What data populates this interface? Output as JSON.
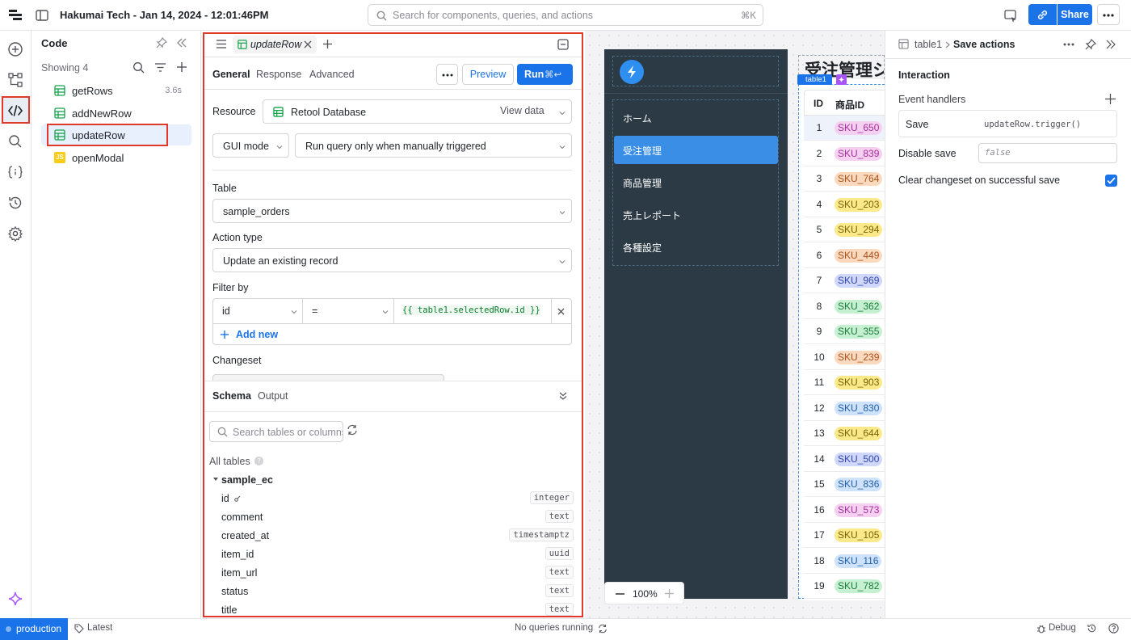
{
  "topbar": {
    "title": "Hakumai Tech - Jan 14, 2024 - 12:01:46PM",
    "search_placeholder": "Search for components, queries, and actions",
    "search_shortcut": "⌘K",
    "share_label": "Share"
  },
  "code_panel": {
    "title": "Code",
    "showing": "Showing 4",
    "queries": [
      {
        "name": "getRows",
        "time": "3.6s",
        "icon": "table-icon"
      },
      {
        "name": "addNewRow",
        "time": "",
        "icon": "table-icon"
      },
      {
        "name": "updateRow",
        "time": "",
        "icon": "table-icon"
      },
      {
        "name": "openModal",
        "time": "",
        "icon": "js-icon"
      }
    ],
    "js_badge": "JS"
  },
  "editor": {
    "tab_name": "updateRow",
    "subtabs": [
      "General",
      "Response",
      "Advanced"
    ],
    "preview_label": "Preview",
    "run_label": "Run",
    "run_shortcut": "⌘↩",
    "resource_label": "Resource",
    "resource_value": "Retool Database",
    "view_data": "View data",
    "mode_value": "GUI mode",
    "trigger_value": "Run query only when manually triggered",
    "table_label": "Table",
    "table_value": "sample_orders",
    "action_type_label": "Action type",
    "action_type_value": "Update an existing record",
    "filter_label": "Filter by",
    "filter_column": "id",
    "filter_operator": "=",
    "filter_value": "{{ table1.selectedRow.id }}",
    "add_new_label": "Add new",
    "changeset_label": "Changeset",
    "bottom_tabs": [
      "Schema",
      "Output"
    ],
    "schema_search_placeholder": "Search tables or columns",
    "all_tables_label": "All tables",
    "schema_table": "sample_ec",
    "schema_columns": [
      {
        "name": "id",
        "type": "integer"
      },
      {
        "name": "comment",
        "type": "text"
      },
      {
        "name": "created_at",
        "type": "timestamptz"
      },
      {
        "name": "item_id",
        "type": "uuid"
      },
      {
        "name": "item_url",
        "type": "text"
      },
      {
        "name": "status",
        "type": "text"
      },
      {
        "name": "title",
        "type": "text"
      }
    ]
  },
  "canvas": {
    "heading": "受注管理シ",
    "table_tag": "table1",
    "nav_items": [
      "ホーム",
      "受注管理",
      "商品管理",
      "売上レポート",
      "各種設定"
    ],
    "active_nav": "受注管理",
    "columns": [
      "ID",
      "商品ID"
    ],
    "rows": [
      {
        "id": "1",
        "sku": "SKU_650",
        "color": "#f5d0f0"
      },
      {
        "id": "2",
        "sku": "SKU_839",
        "color": "#f5d0f0"
      },
      {
        "id": "3",
        "sku": "SKU_764",
        "color": "#fbd9bf"
      },
      {
        "id": "4",
        "sku": "SKU_203",
        "color": "#fbe98a"
      },
      {
        "id": "5",
        "sku": "SKU_294",
        "color": "#fbe98a"
      },
      {
        "id": "6",
        "sku": "SKU_449",
        "color": "#fbd9bf"
      },
      {
        "id": "7",
        "sku": "SKU_969",
        "color": "#cfd8fb"
      },
      {
        "id": "8",
        "sku": "SKU_362",
        "color": "#c6f0d2"
      },
      {
        "id": "9",
        "sku": "SKU_355",
        "color": "#c6f0d2"
      },
      {
        "id": "10",
        "sku": "SKU_239",
        "color": "#fbd9bf"
      },
      {
        "id": "11",
        "sku": "SKU_903",
        "color": "#fbe98a"
      },
      {
        "id": "12",
        "sku": "SKU_830",
        "color": "#cfe2fb"
      },
      {
        "id": "13",
        "sku": "SKU_644",
        "color": "#fbe98a"
      },
      {
        "id": "14",
        "sku": "SKU_500",
        "color": "#cfd8fb"
      },
      {
        "id": "15",
        "sku": "SKU_836",
        "color": "#cfe2fb"
      },
      {
        "id": "16",
        "sku": "SKU_573",
        "color": "#f5d0f0"
      },
      {
        "id": "17",
        "sku": "SKU_105",
        "color": "#fbe98a"
      },
      {
        "id": "18",
        "sku": "SKU_116",
        "color": "#cfe2fb"
      },
      {
        "id": "19",
        "sku": "SKU_782",
        "color": "#c6f0d2"
      }
    ],
    "zoom": "100%"
  },
  "inspector": {
    "breadcrumb_parent": "table1",
    "breadcrumb_current": "Save actions",
    "section": "Interaction",
    "event_handlers_label": "Event handlers",
    "handler_event": "Save",
    "handler_action": "updateRow.trigger()",
    "disable_save_label": "Disable save",
    "disable_save_value": "false",
    "clear_changeset_label": "Clear changeset on successful save",
    "clear_changeset_checked": true
  },
  "footer": {
    "env": "production",
    "version": "Latest",
    "status": "No queries running",
    "debug": "Debug"
  },
  "colors": {
    "accent": "#1a73e8",
    "highlight": "#e0392b",
    "nav_bg": "#2b3a44",
    "nav_active": "#3a8ee6"
  }
}
